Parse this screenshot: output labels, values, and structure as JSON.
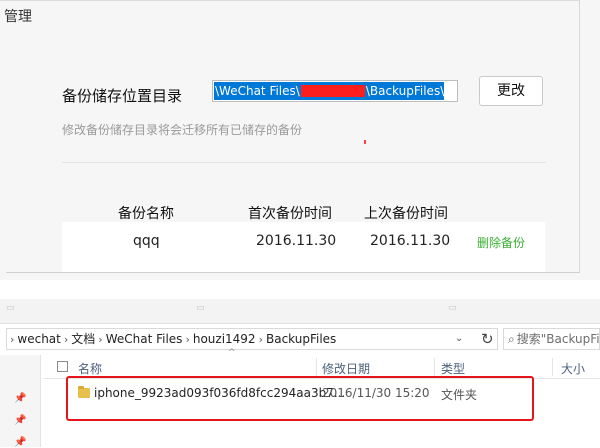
{
  "wechat": {
    "title": "管理",
    "path_label": "备份储存位置目录",
    "path_part1": "\\WeChat Files\\",
    "path_part2": "\\BackupFiles\\",
    "change_button": "更改",
    "hint": "修改备份储存目录将会迁移所有已储存的备份",
    "columns": [
      "备份名称",
      "首次备份时间",
      "上次备份时间"
    ],
    "row": {
      "name": "qqq",
      "first": "2016.11.30",
      "last": "2016.11.30",
      "delete": "删除备份"
    }
  },
  "explorer": {
    "breadcrumb": [
      "wechat",
      "文档",
      "WeChat Files",
      "houzi1492",
      "BackupFiles"
    ],
    "search_placeholder": "搜索\"BackupFiles",
    "columns": [
      "名称",
      "修改日期",
      "类型",
      "大小"
    ],
    "file": {
      "name": "iphone_9923ad093f036fd8fcc294aa3b7...",
      "date": "2016/11/30 15:20",
      "type": "文件夹"
    },
    "icons": [
      "folder-icon",
      "search-icon",
      "refresh-icon",
      "pin-icon",
      "sort-up-icon",
      "chevron-right-icon"
    ]
  },
  "colors": {
    "accent_selection": "#0078d7",
    "delete_link": "#3cb034",
    "highlight": "#e4161b",
    "redaction": "#ff1e1e"
  }
}
